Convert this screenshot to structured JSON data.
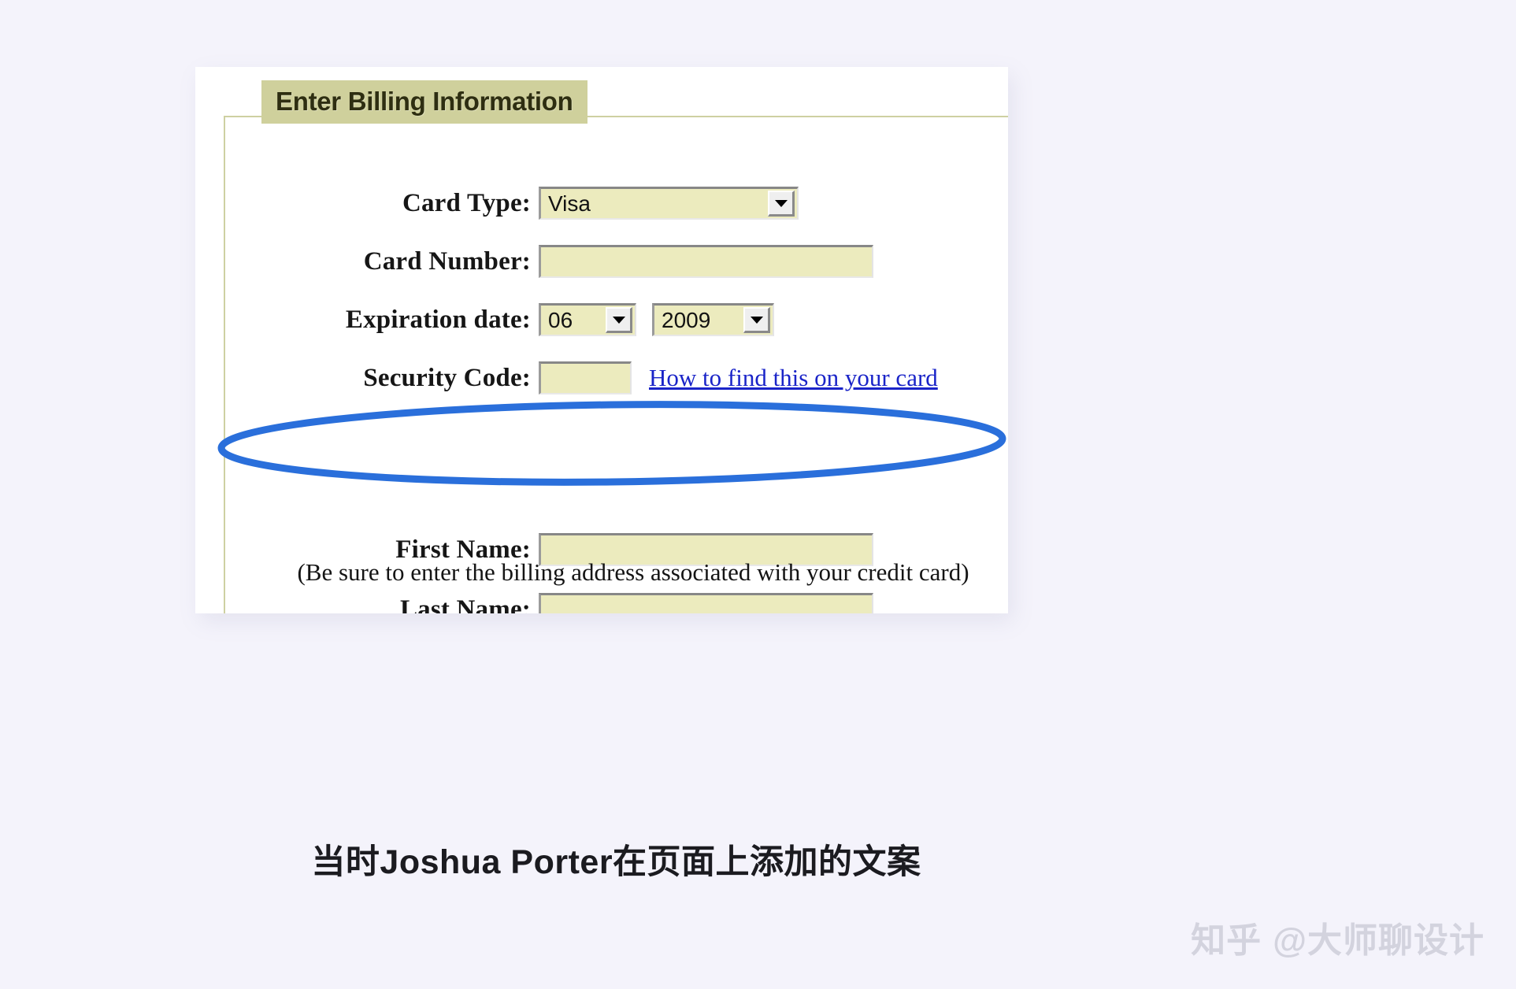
{
  "page": {
    "background_color": "#f4f3fb",
    "card_background": "#ffffff"
  },
  "form": {
    "legend": "Enter Billing Information",
    "legend_bg_color": "#cfd09c",
    "border_color": "#ced0a2",
    "input_bg_color": "#ecebbe",
    "rows": [
      {
        "label": "Card Type:",
        "control": "select",
        "value": "Visa"
      },
      {
        "label": "Card Number:",
        "control": "text",
        "value": ""
      },
      {
        "label": "Expiration date:",
        "control": "select-pair",
        "month_value": "06",
        "year_value": "2009"
      },
      {
        "label": "Security Code:",
        "control": "text-with-link",
        "value": "",
        "link_text": "How to find this on your card",
        "link_color": "#1a24c8"
      },
      {
        "label": "First Name:",
        "control": "text",
        "value": ""
      },
      {
        "label": "Last Name:",
        "control": "text",
        "value": ""
      }
    ],
    "note": "(Be sure to enter the billing address associated with your credit card)"
  },
  "annotation": {
    "shape": "ellipse",
    "color": "#2a6fdb",
    "stroke_width": 9
  },
  "caption": {
    "text": "当时Joshua Porter在页面上添加的文案"
  },
  "watermark": {
    "brand": "知乎",
    "handle": "@大师聊设计",
    "color": "#d3d3de"
  }
}
